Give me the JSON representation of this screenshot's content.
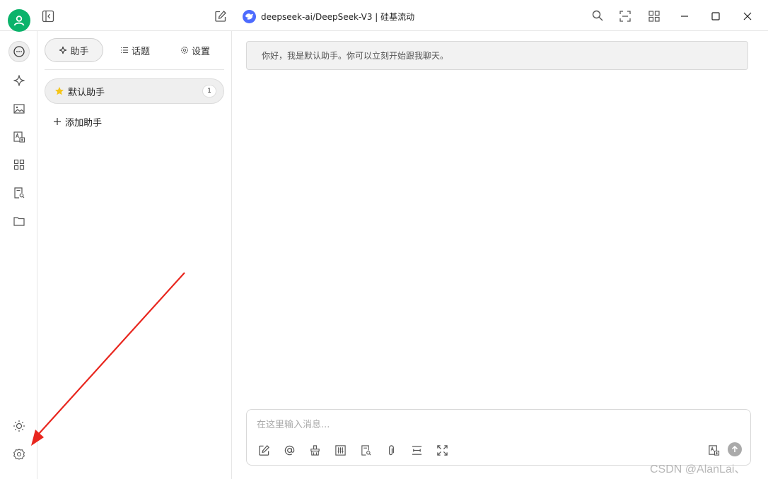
{
  "window": {
    "model_name": "deepseek-ai/DeepSeek-V3 | 硅基流动",
    "icons": [
      "user-avatar-icon",
      "sidebar-toggle-icon",
      "edit-icon",
      "search-icon",
      "scan-icon",
      "apps-icon",
      "minimize-icon",
      "maximize-icon",
      "close-icon"
    ]
  },
  "rail": {
    "items": [
      "chat-icon",
      "sparkle-icon",
      "image-icon",
      "translate-icon",
      "apps-icon",
      "file-search-icon",
      "folder-icon"
    ],
    "bottom": [
      "theme-icon",
      "settings-icon"
    ]
  },
  "panel": {
    "tabs": [
      {
        "label": "助手",
        "icon": "sparkle-icon"
      },
      {
        "label": "话题",
        "icon": "list-icon"
      },
      {
        "label": "设置",
        "icon": "gear-icon"
      }
    ],
    "assistant": {
      "name": "默认助手",
      "count": "1",
      "icon": "star-icon"
    },
    "add_label": "添加助手"
  },
  "chat": {
    "greeting": "你好，我是默认助手。你可以立刻开始跟我聊天。",
    "input_placeholder": "在这里输入消息...",
    "tools": [
      "new-topic-icon",
      "mention-icon",
      "clear-icon",
      "settings-sliders-icon",
      "web-search-icon",
      "attachment-icon",
      "divider-icon",
      "fullscreen-icon"
    ]
  },
  "watermark": "CSDN @AlanLai、",
  "colors": {
    "accent": "#0bb36b",
    "deepseek": "#4d6bfe",
    "arrow": "#e8261e"
  }
}
